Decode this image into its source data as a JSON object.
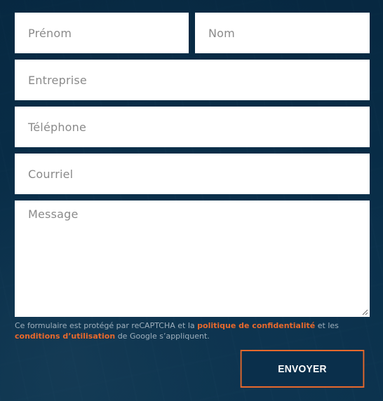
{
  "form": {
    "fields": {
      "prenom_placeholder": "Prénom",
      "nom_placeholder": "Nom",
      "entreprise_placeholder": "Entreprise",
      "telephone_placeholder": "Téléphone",
      "courriel_placeholder": "Courriel",
      "message_placeholder": "Message"
    },
    "notice": {
      "text_before": "Ce formulaire est protégé par reCAPTCHA et la ",
      "privacy_link": "politique de confidentialité",
      "text_middle": " et les ",
      "terms_link": "conditions d’utilisation",
      "text_after": " de Google s’appliquent."
    },
    "submit_label": "ENVOYER"
  },
  "colors": {
    "accent": "#e8692c",
    "field_bg": "#ffffff",
    "placeholder": "#8a8a8a",
    "notice_text": "#9fb0bd",
    "background": "#0d3856"
  },
  "icons": {
    "textarea_resize": "resize-grip-icon"
  }
}
